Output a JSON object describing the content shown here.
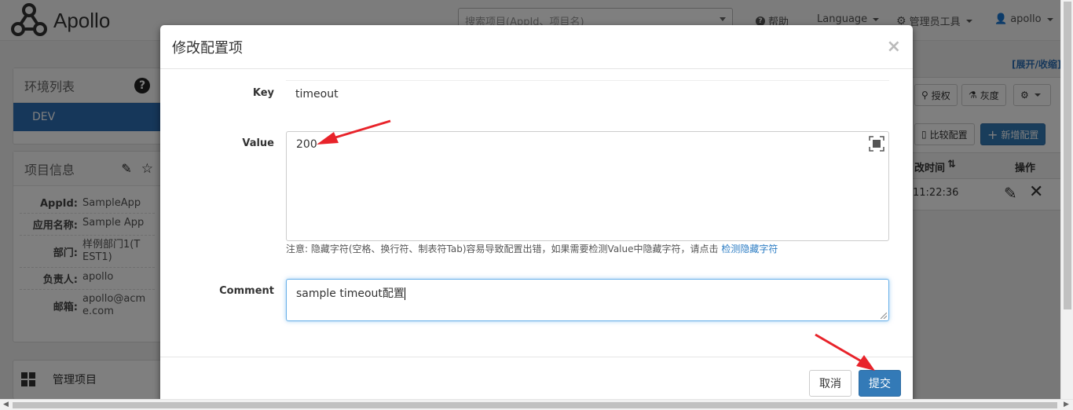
{
  "navbar": {
    "logo_text": "Apollo",
    "search_placeholder": "搜索项目(AppId、项目名)",
    "help": "帮助",
    "language": "Language",
    "admin_tools": "管理员工具",
    "user": "apollo"
  },
  "sidebar": {
    "env_title": "环境列表",
    "env_item": "DEV",
    "project_title": "项目信息",
    "info": [
      {
        "label": "AppId:",
        "value": "SampleApp"
      },
      {
        "label": "应用名称:",
        "value": "Sample App"
      },
      {
        "label": "部门:",
        "value": "样例部门1(TEST1)"
      },
      {
        "label": "负责人:",
        "value": "apollo"
      },
      {
        "label": "邮箱:",
        "value": "apollo@acme.com"
      }
    ],
    "manage": "管理项目"
  },
  "background": {
    "expand_collapse": "[展开/收缩]",
    "auth_button": "授权",
    "gray_button": "灰度",
    "compare_button": "比较配置",
    "add_button": "新增配置",
    "col_modified": "改时间",
    "col_ops": "操作",
    "row_time": "11:22:36"
  },
  "modal": {
    "title": "修改配置项",
    "close": "×",
    "key_label": "Key",
    "key_value": "timeout",
    "value_label": "Value",
    "value_value": "200",
    "note_text": "注意: 隐藏字符(空格、换行符、制表符Tab)容易导致配置出错，如果需要检测Value中隐藏字符，请点击",
    "note_link": "检测隐藏字符",
    "comment_label": "Comment",
    "comment_value": "sample timeout配置",
    "cancel_label": "取消",
    "submit_label": "提交"
  },
  "colors": {
    "primary": "#337ab7",
    "env_active": "#2d6fb5",
    "annotation_arrow": "#e8232a"
  }
}
